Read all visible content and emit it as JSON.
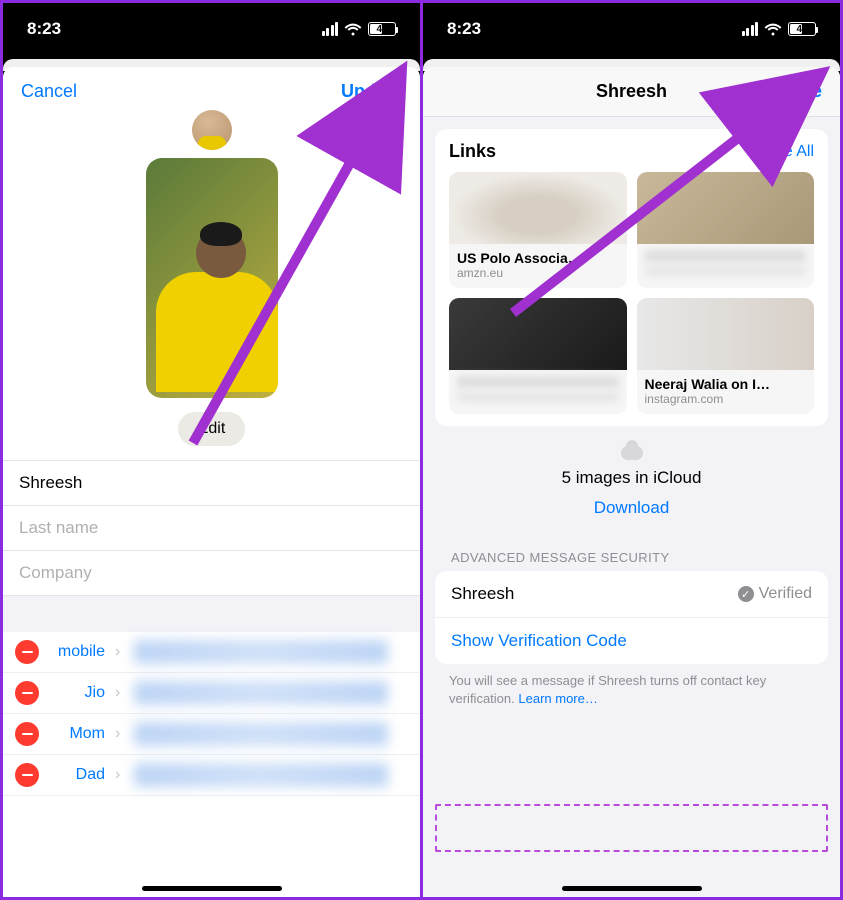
{
  "status": {
    "time": "8:23",
    "battery": "47"
  },
  "left": {
    "cancel": "Cancel",
    "update": "Update",
    "edit": "Edit",
    "first_name": "Shreesh",
    "last_name_ph": "Last name",
    "company_ph": "Company",
    "phones": [
      {
        "label": "mobile"
      },
      {
        "label": "Jio"
      },
      {
        "label": "Mom"
      },
      {
        "label": "Dad"
      }
    ]
  },
  "right": {
    "title": "Shreesh",
    "done": "Done",
    "links_header": "Links",
    "see_all": "See All",
    "links": [
      {
        "title": "US Polo Associa…",
        "sub": "amzn.eu"
      },
      {
        "title": "",
        "sub": ""
      },
      {
        "title": "",
        "sub": ""
      },
      {
        "title": "Neeraj Walia on I…",
        "sub": "instagram.com"
      }
    ],
    "icloud_text": "5 images in iCloud",
    "download": "Download",
    "section_label": "ADVANCED MESSAGE SECURITY",
    "verify_name": "Shreesh",
    "verified": "Verified",
    "show_code": "Show Verification Code",
    "footnote": "You will see a message if Shreesh turns off contact key verification. ",
    "learn_more": "Learn more…"
  }
}
